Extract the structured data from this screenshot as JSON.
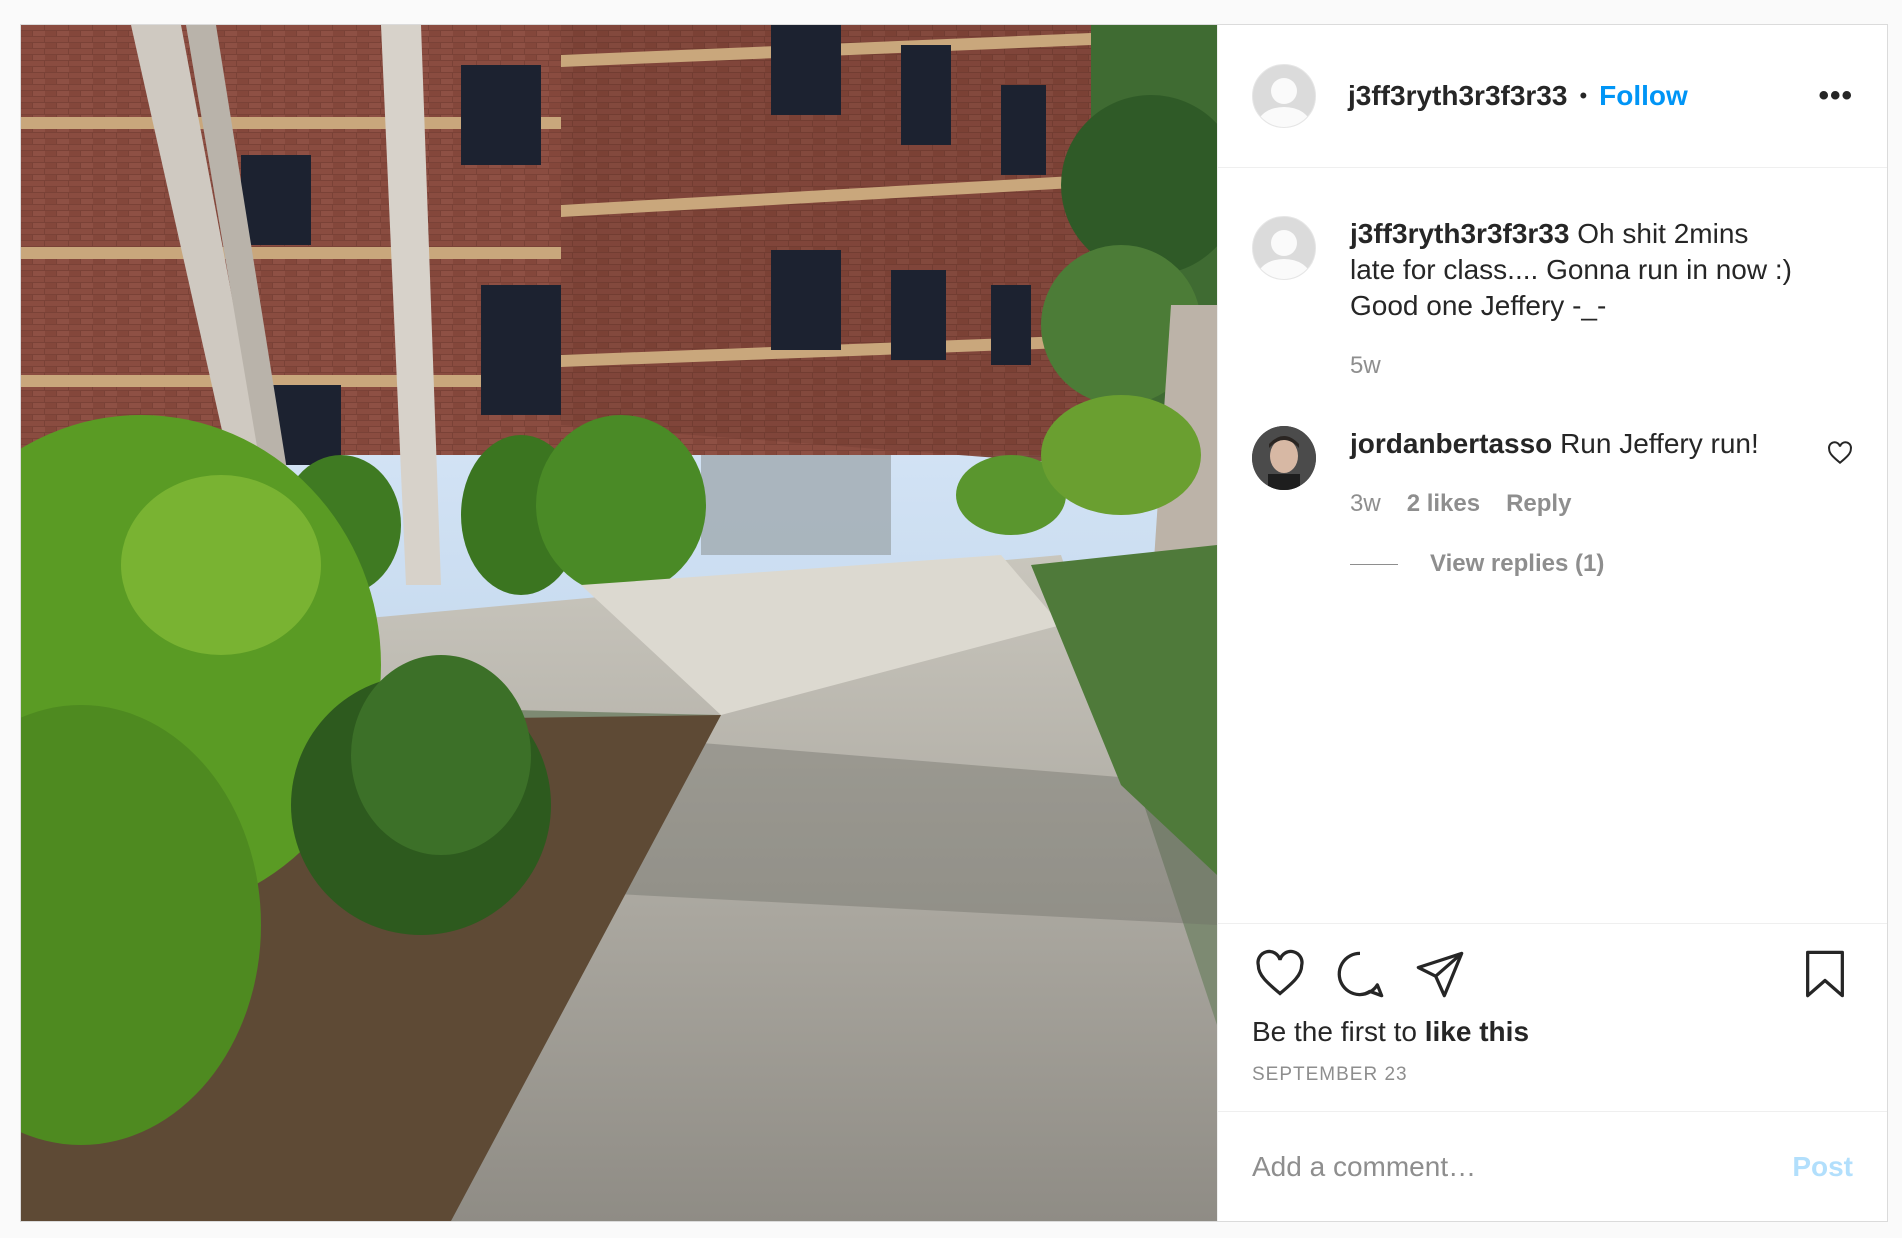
{
  "post": {
    "author": "j3ff3ryth3r3f3r33",
    "separator": "•",
    "follow_label": "Follow",
    "more_label": "•••"
  },
  "caption": {
    "author": "j3ff3ryth3r3f3r33",
    "text": "Oh shit 2mins late for class.... Gonna run in now :) Good one Jeffery -_-",
    "age": "5w"
  },
  "comments": [
    {
      "author": "jordanbertasso",
      "text": "Run Jeffery run!",
      "age": "3w",
      "likes": "2 likes",
      "reply_label": "Reply",
      "view_replies": "View replies (1)"
    }
  ],
  "actions": {
    "likes_prefix": "Be the first to",
    "likes_action": "like this",
    "date": "SEPTEMBER 23"
  },
  "add_comment": {
    "placeholder": "Add a comment…",
    "post_label": "Post"
  },
  "colors": {
    "link_blue": "#0095f6",
    "post_disabled": "#b2dffc",
    "muted": "#8e8e8e"
  }
}
